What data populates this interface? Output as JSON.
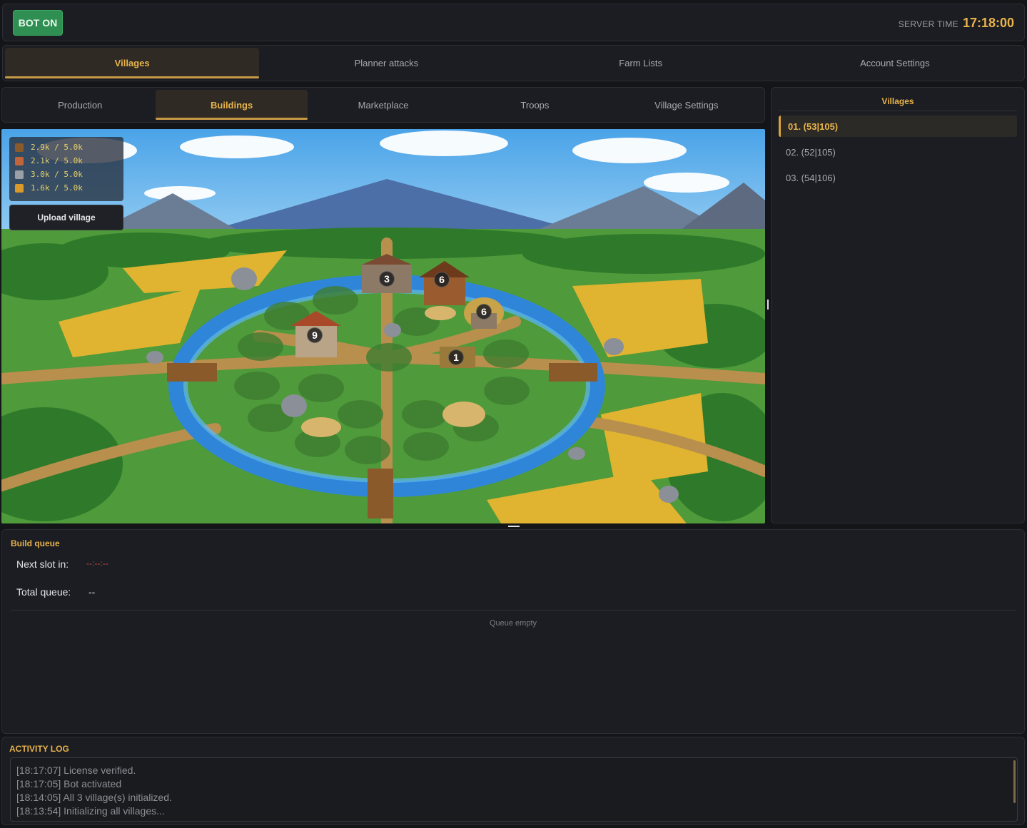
{
  "topbar": {
    "bot_label": "BOT ON",
    "server_time_label": "SERVER TIME",
    "server_time": "17:18:00"
  },
  "main_tabs": [
    {
      "label": "Villages",
      "active": true
    },
    {
      "label": "Planner attacks",
      "active": false
    },
    {
      "label": "Farm Lists",
      "active": false
    },
    {
      "label": "Account Settings",
      "active": false
    }
  ],
  "sub_tabs": [
    {
      "label": "Production",
      "active": false
    },
    {
      "label": "Buildings",
      "active": true
    },
    {
      "label": "Marketplace",
      "active": false
    },
    {
      "label": "Troops",
      "active": false
    },
    {
      "label": "Village Settings",
      "active": false
    }
  ],
  "resources": [
    {
      "icon": "wood-icon",
      "value": "2.9k / 5.0k"
    },
    {
      "icon": "clay-icon",
      "value": "2.1k / 5.0k"
    },
    {
      "icon": "iron-icon",
      "value": "3.0k / 5.0k"
    },
    {
      "icon": "crop-icon",
      "value": "1.6k / 5.0k"
    }
  ],
  "upload_label": "Upload village",
  "building_levels": [
    "3",
    "6",
    "6",
    "9",
    "1"
  ],
  "villages": {
    "title": "Villages",
    "items": [
      {
        "label": "01.  (53|105)",
        "active": true
      },
      {
        "label": "02.  (52|105)",
        "active": false
      },
      {
        "label": "03.  (54|106)",
        "active": false
      }
    ]
  },
  "build_queue": {
    "title": "Build queue",
    "next_slot_label": "Next slot in:",
    "next_slot_value": "--:--:--",
    "total_queue_label": "Total queue:",
    "total_queue_value": "--",
    "empty_text": "Queue empty"
  },
  "activity_log": {
    "title": "ACTIVITY LOG",
    "lines": [
      "[18:17:07] License verified.",
      "[18:17:05] Bot activated",
      "[18:14:05] All 3 village(s) initialized.",
      "[18:13:54] Initializing all villages..."
    ]
  },
  "colors": {
    "accent": "#e8b34a",
    "bot_on": "#2f8f52",
    "background": "#141519",
    "panel": "#1c1d22"
  }
}
